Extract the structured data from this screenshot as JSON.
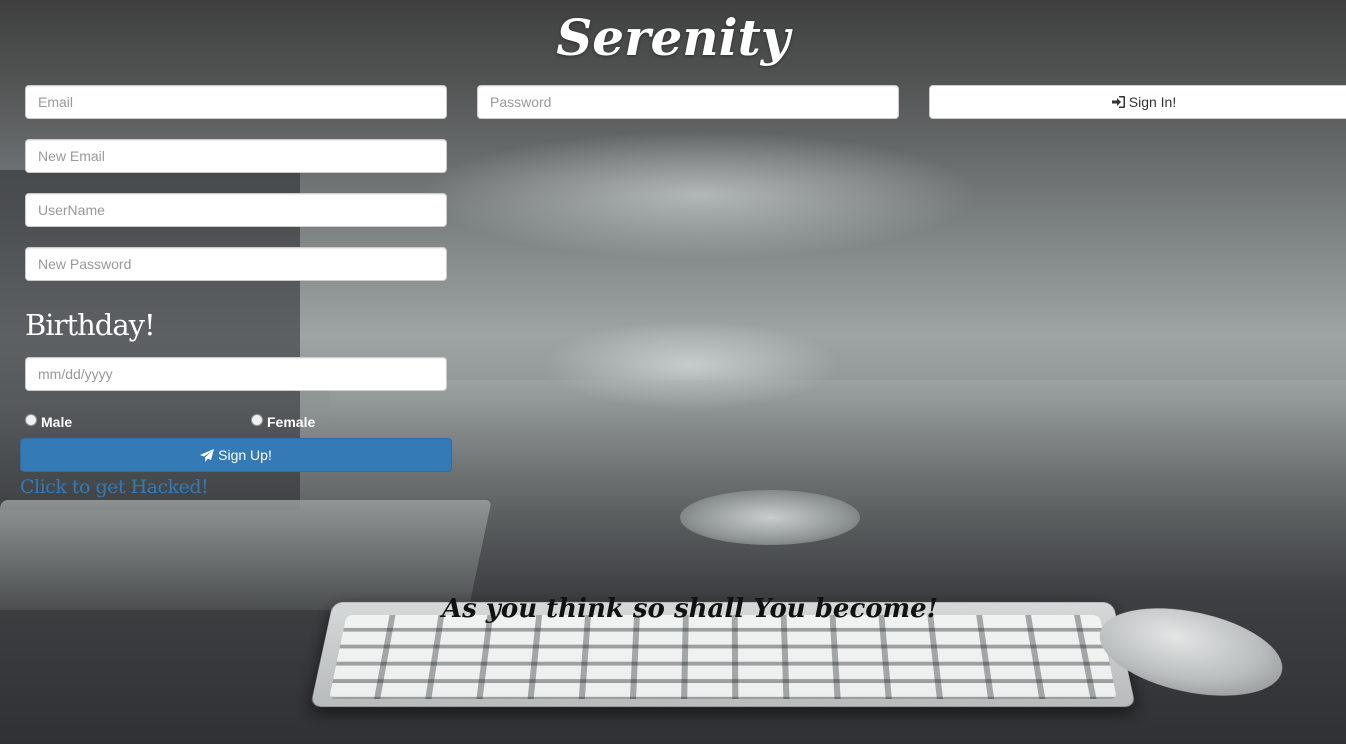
{
  "app": {
    "title": "Serenity"
  },
  "login": {
    "email_placeholder": "Email",
    "password_placeholder": "Password",
    "signin_label": "Sign In!",
    "signin_icon": "sign-in-icon"
  },
  "signup": {
    "new_email_placeholder": "New Email",
    "username_placeholder": "UserName",
    "new_password_placeholder": "New Password",
    "birthday_heading": "Birthday!",
    "birthday_placeholder": "mm/dd/yyyy",
    "gender_options": [
      "Male",
      "Female"
    ],
    "signup_label": "Sign Up!",
    "signup_icon": "paper-plane-icon",
    "hack_link": "Click to get Hacked!"
  },
  "quote": "As you think so shall You become!",
  "colors": {
    "primary": "#337ab7",
    "text_light": "#ffffff"
  }
}
